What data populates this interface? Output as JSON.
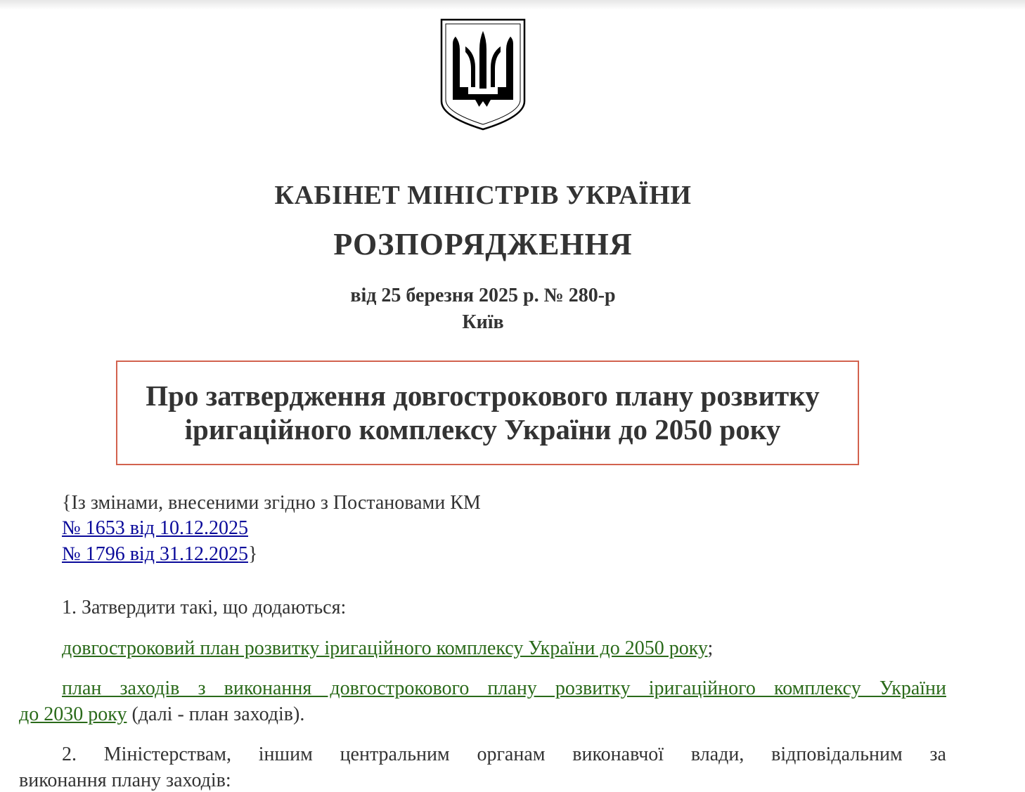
{
  "header": {
    "emblem_icon": "trident-coat-of-arms-icon",
    "cabinet": "КАБІНЕТ МІНІСТРІВ УКРАЇНИ",
    "doc_type": "РОЗПОРЯДЖЕННЯ",
    "date_number": "від 25 березня 2025 р. № 280-р",
    "city": "Київ"
  },
  "title": {
    "line1": "Про затвердження довгострокового плану розвитку",
    "line2": "іригаційного комплексу України до 2050 року",
    "border_color": "#d2624e"
  },
  "amendments": {
    "intro": "{Із змінами, внесеними згідно з Постановами КМ",
    "link1": "№ 1653 від 10.12.2025",
    "link2": "№ 1796 від 31.12.2025",
    "close": "}"
  },
  "body": {
    "p1": "1. Затвердити  такі, що додаються:",
    "p1a_link": "довгостроковий план розвитку іригаційного комплексу України до 2050 року",
    "p1a_tail": ";",
    "p1b_link_line1": "план заходів з виконання довгострокового плану розвитку іригаційного комплексу України",
    "p1b_link_line2": "до 2030 року",
    "p1b_tail": " (далі - план заходів).",
    "p2_line1": "2. Міністерствам, іншим центральним органам виконавчої влади, відповідальним за",
    "p2_line2": "виконання плану заходів:"
  },
  "colors": {
    "link": "#0a0a9a",
    "green_link": "#2a6a1a"
  }
}
